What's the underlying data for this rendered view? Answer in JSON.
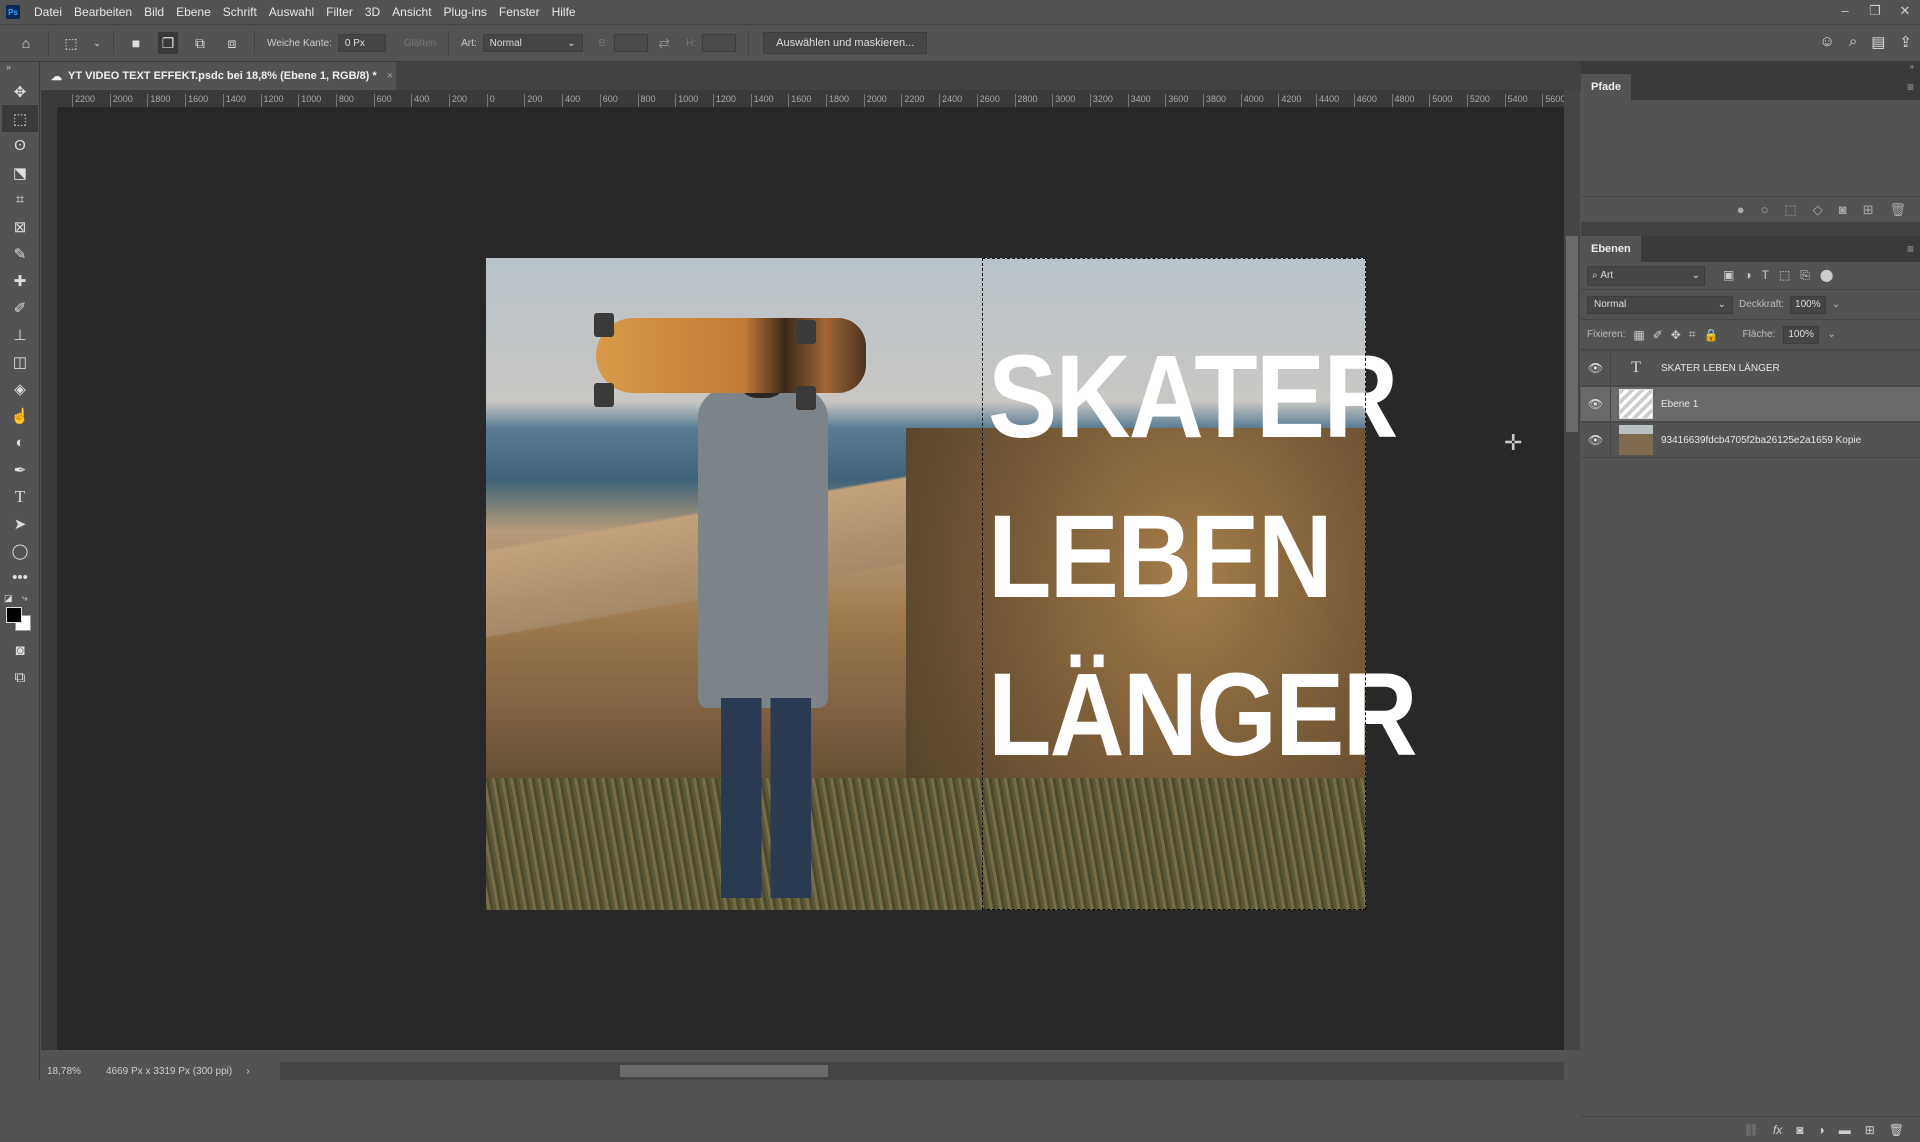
{
  "app": {
    "logo": "Ps"
  },
  "menu": [
    "Datei",
    "Bearbeiten",
    "Bild",
    "Ebene",
    "Schrift",
    "Auswahl",
    "Filter",
    "3D",
    "Ansicht",
    "Plug-ins",
    "Fenster",
    "Hilfe"
  ],
  "window_controls": {
    "minimize": "–",
    "restore": "❐",
    "close": "✕"
  },
  "options": {
    "feather_label": "Weiche Kante:",
    "feather_value": "0 Px",
    "antialias_label": "Glätten",
    "style_label": "Art:",
    "style_value": "Normal",
    "width_label": "B:",
    "height_label": "H:",
    "select_mask_button": "Auswählen und maskieren..."
  },
  "document_tab": {
    "title": "YT VIDEO TEXT EFFEKT.psdc bei 18,8% (Ebene 1, RGB/8) *",
    "close": "×"
  },
  "ruler_h": [
    "2200",
    "2000",
    "1800",
    "1600",
    "1400",
    "1200",
    "1000",
    "800",
    "600",
    "400",
    "200",
    "0",
    "200",
    "400",
    "600",
    "800",
    "1000",
    "1200",
    "1400",
    "1600",
    "1800",
    "2000",
    "2200",
    "2400",
    "2600",
    "2800",
    "3000",
    "3200",
    "3400",
    "3600",
    "3800",
    "4000",
    "4200",
    "4400",
    "4600",
    "4800",
    "5000",
    "5200",
    "5400",
    "5600"
  ],
  "canvas_text": [
    "SKATER",
    "LEBEN",
    "LÄNGER"
  ],
  "status": {
    "zoom": "18,78%",
    "info": "4669 Px x 3319 Px (300 ppi)"
  },
  "paths_panel": {
    "title": "Pfade"
  },
  "layers_panel": {
    "title": "Ebenen",
    "filter_kind": "Art",
    "blend_mode": "Normal",
    "opacity_label": "Deckkraft:",
    "opacity_value": "100%",
    "lock_label": "Fixieren:",
    "fill_label": "Fläche:",
    "fill_value": "100%",
    "layers": [
      {
        "name": "SKATER LEBEN LÄNGER",
        "type": "text",
        "visible": true,
        "selected": false
      },
      {
        "name": "Ebene 1",
        "type": "pixel",
        "visible": true,
        "selected": true
      },
      {
        "name": "93416639fdcb4705f2ba26125e2a1659  Kopie",
        "type": "smart-object",
        "visible": true,
        "selected": false
      }
    ]
  }
}
